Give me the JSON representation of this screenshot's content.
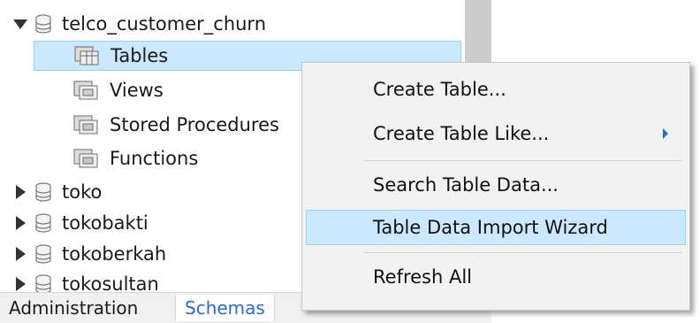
{
  "tree": {
    "expanded_schema": {
      "name": "telco_customer_churn",
      "children": [
        {
          "label": "Tables",
          "selected": true
        },
        {
          "label": "Views",
          "selected": false
        },
        {
          "label": "Stored Procedures",
          "selected": false
        },
        {
          "label": "Functions",
          "selected": false
        }
      ]
    },
    "collapsed_schemas": [
      "toko",
      "tokobakti",
      "tokoberkah",
      "tokosultan"
    ]
  },
  "bottom_tabs": {
    "administration": "Administration",
    "schemas": "Schemas"
  },
  "context_menu": {
    "items": [
      {
        "label": "Create Table...",
        "has_submenu": false,
        "highlighted": false
      },
      {
        "label": "Create Table Like...",
        "has_submenu": true,
        "highlighted": false
      },
      {
        "label": "Search Table Data...",
        "has_submenu": false,
        "highlighted": false
      },
      {
        "label": "Table Data Import Wizard",
        "has_submenu": false,
        "highlighted": true
      },
      {
        "label": "Refresh All",
        "has_submenu": false,
        "highlighted": false
      }
    ]
  },
  "colors": {
    "selection_fill": "#cce8ff",
    "selection_border": "#99d1ff",
    "schemas_tab_text": "#2a6bd1",
    "menu_background": "#f2f2f2",
    "submenu_arrow": "#1a6fd1"
  }
}
